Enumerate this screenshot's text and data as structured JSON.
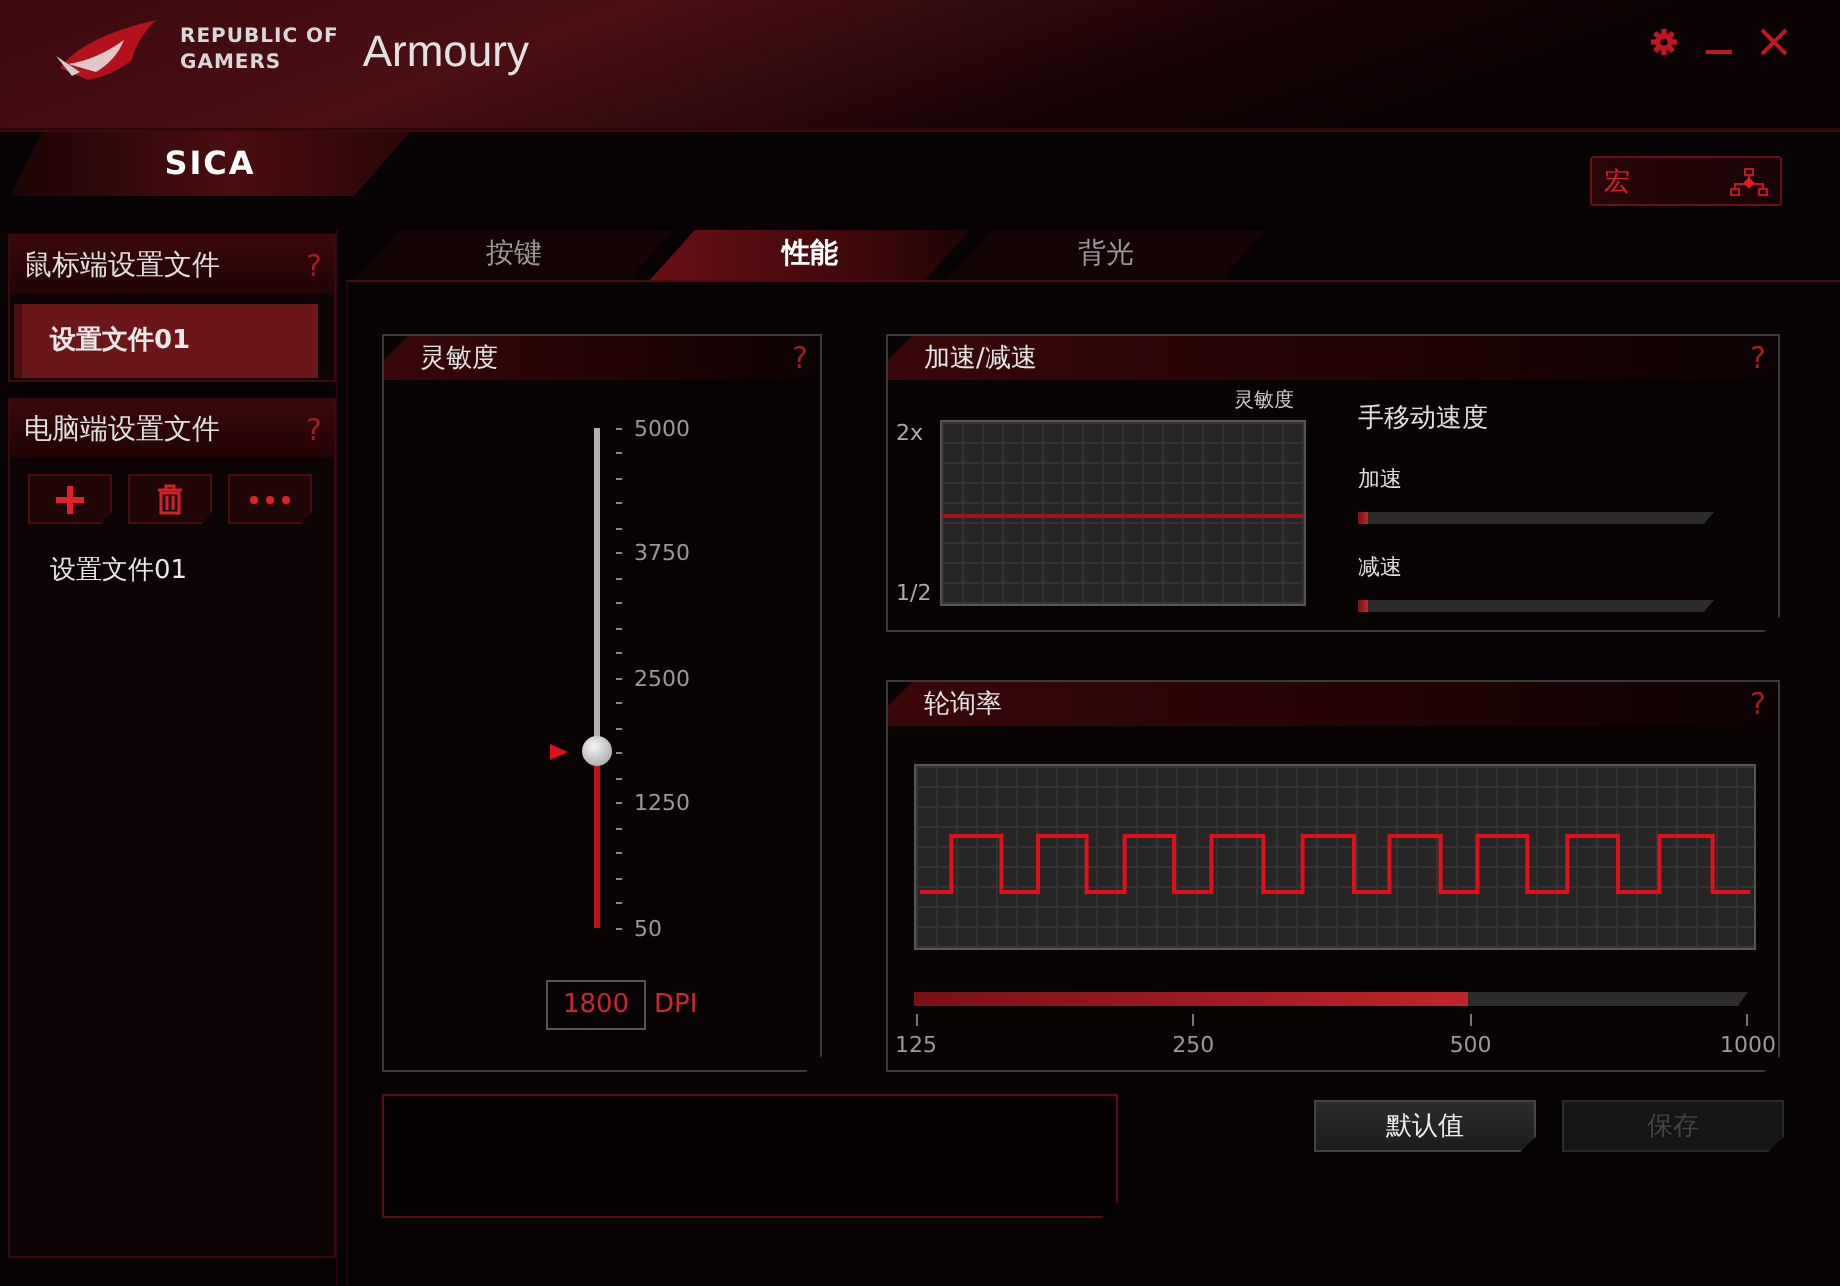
{
  "header": {
    "brand_lines": [
      "REPUBLIC OF",
      "GAMERS"
    ],
    "app_title": "Armoury"
  },
  "device": {
    "name": "SICA",
    "selected": true
  },
  "macro_button": {
    "label": "宏"
  },
  "mouse_profiles": {
    "title": "鼠标端设置文件",
    "help": "?",
    "items": [
      {
        "label": "设置文件01",
        "selected": true
      }
    ]
  },
  "pc_profiles": {
    "title": "电脑端设置文件",
    "help": "?",
    "items": [
      {
        "label": "设置文件01",
        "selected": false
      }
    ]
  },
  "tabs": [
    {
      "label": "按键",
      "selected": false
    },
    {
      "label": "性能",
      "selected": true
    },
    {
      "label": "背光",
      "selected": false
    }
  ],
  "sensitivity": {
    "title": "灵敏度",
    "help": "?",
    "ticks": [
      "5000",
      "3750",
      "2500",
      "1250",
      "50"
    ],
    "level": 0.352,
    "value": "1800",
    "unit": "DPI"
  },
  "acceleration": {
    "title": "加速/减速",
    "help": "?",
    "graph_label": "灵敏度",
    "y_top": "2x",
    "y_bottom": "1/2",
    "heading": "手移动速度",
    "sliders": [
      {
        "label": "加速",
        "level": 0.03
      },
      {
        "label": "减速",
        "level": 0.03
      }
    ]
  },
  "polling": {
    "title": "轮询率",
    "help": "?",
    "level": 0.665,
    "ticks": [
      "125",
      "250",
      "500",
      "1000"
    ]
  },
  "buttons": [
    {
      "label": "默认值",
      "disabled": false
    },
    {
      "label": "保存",
      "disabled": true
    }
  ]
}
